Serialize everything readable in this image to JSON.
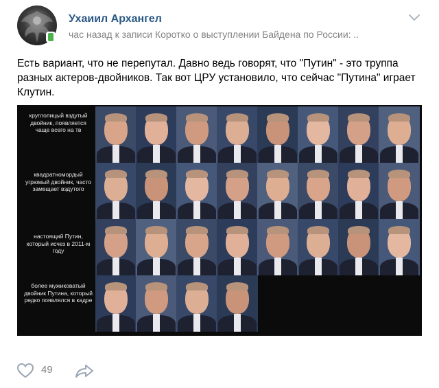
{
  "post": {
    "author": "Ухаиил Архангел",
    "meta_time": "час назад",
    "meta_prefix": "к записи",
    "meta_link": "Коротко о выступлении Байдена по России:",
    "meta_ellipsis": "..",
    "text": "Есть вариант, что не перепутал. Давно ведь говорят, что \"Путин\" - это труппа разных актеров-двойников. Так вот ЦРУ установило, что сейчас \"Путина\" играет Клутин.",
    "image": {
      "row_labels": [
        "круглолицый вздутый двойник, появляется чаще всего на тв",
        "квадратномордый угрюмый двойник, часто замещает вздутого",
        "настоящий Путин, который исчез в 2011-м году",
        "более мужиковатый двойник Путина, который редко появлялся в кадре"
      ],
      "row_counts": [
        8,
        8,
        8,
        4
      ]
    },
    "likes": "49"
  },
  "colors": {
    "link": "#2a5885",
    "meta": "#828282",
    "image_bg": "#0b0b0b"
  },
  "icons": {
    "menu": "chevron-down-icon",
    "like": "heart-icon",
    "share": "share-arrow-icon"
  }
}
